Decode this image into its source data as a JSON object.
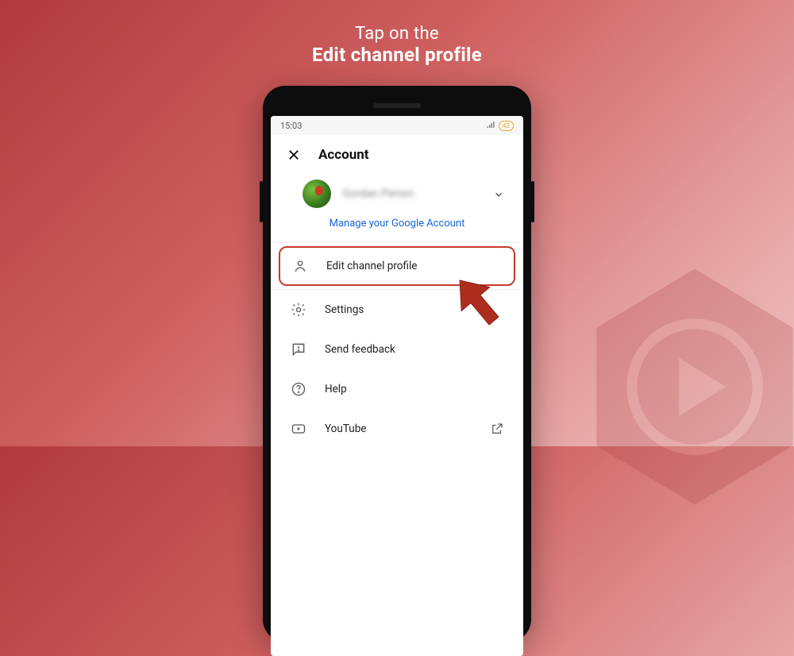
{
  "instruction": {
    "line1": "Tap on the",
    "line2": "Edit channel profile"
  },
  "status_bar": {
    "time": "15:03",
    "battery": "42"
  },
  "header": {
    "title": "Account"
  },
  "user": {
    "name": "Gordan Perisic"
  },
  "manage_link": "Manage your Google Account",
  "menu": [
    {
      "label": "Edit channel profile",
      "icon": "person-icon"
    },
    {
      "label": "Settings",
      "icon": "gear-icon"
    },
    {
      "label": "Send feedback",
      "icon": "feedback-icon"
    },
    {
      "label": "Help",
      "icon": "help-icon"
    },
    {
      "label": "YouTube",
      "icon": "youtube-icon"
    }
  ],
  "colors": {
    "highlight_border": "#c63b2b",
    "link_blue": "#1565d8"
  }
}
